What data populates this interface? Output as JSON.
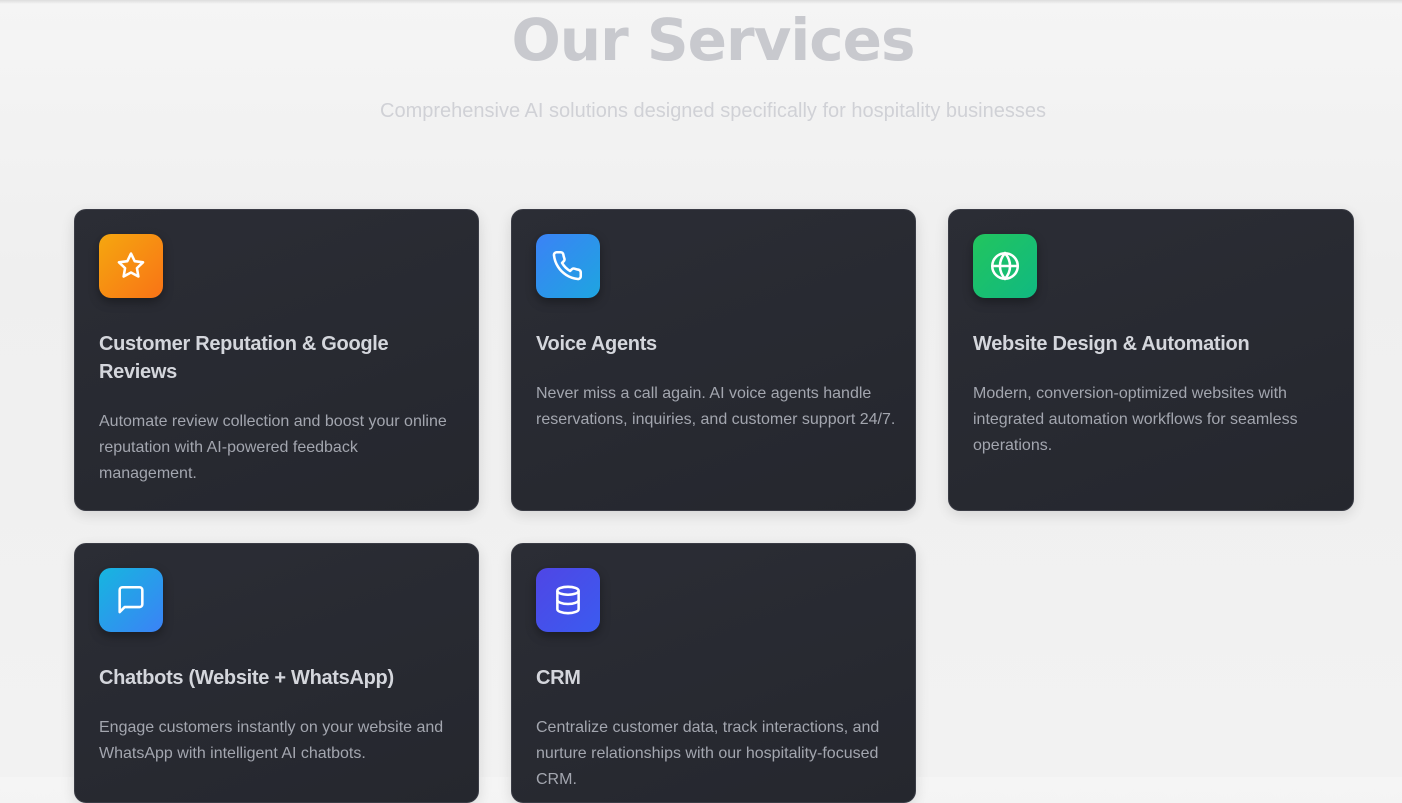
{
  "header": {
    "title": "Our Services",
    "subtitle": "Comprehensive AI solutions designed specifically for hospitality businesses"
  },
  "services": [
    {
      "title": "Customer Reputation & Google Reviews",
      "description": "Automate review collection and boost your online reputation with AI-powered feedback management.",
      "icon": "star-icon",
      "icon_gradient": [
        "#f5a70f",
        "#f97316"
      ]
    },
    {
      "title": "Voice Agents",
      "description": "Never miss a call again. AI voice agents handle reservations, inquiries, and customer support 24/7.",
      "icon": "phone-icon",
      "icon_gradient": [
        "#3b82f6",
        "#1ea5e0"
      ]
    },
    {
      "title": "Website Design & Automation",
      "description": "Modern, conversion-optimized websites with integrated automation workflows for seamless operations.",
      "icon": "globe-icon",
      "icon_gradient": [
        "#22c55e",
        "#10b981"
      ]
    },
    {
      "title": "Chatbots (Website + WhatsApp)",
      "description": "Engage customers instantly on your website and WhatsApp with intelligent AI chatbots.",
      "icon": "chat-bubble-icon",
      "icon_gradient": [
        "#16b6df",
        "#3b82f6"
      ]
    },
    {
      "title": "CRM",
      "description": "Centralize customer data, track interactions, and nurture relationships with our hospitality-focused CRM.",
      "icon": "database-icon",
      "icon_gradient": [
        "#4f46e5",
        "#3b5bf0"
      ]
    }
  ]
}
